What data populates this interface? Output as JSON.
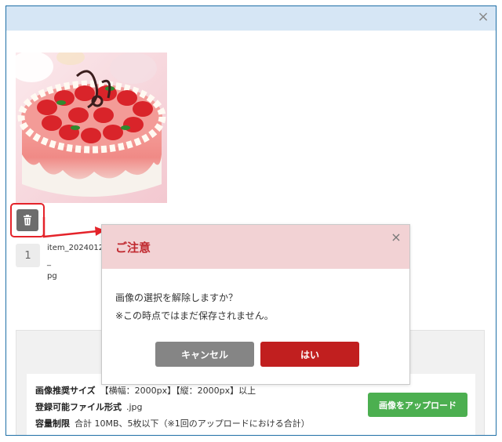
{
  "window": {
    "close_icon": "×"
  },
  "photo": {
    "alt": "strawberry-cake-photo"
  },
  "item": {
    "number": "1",
    "filename": "item_20240123_\npg"
  },
  "upload": {
    "recommended_size_label": "画像推奨サイズ",
    "recommended_size_value": "【横幅：2000px】【縦：2000px】以上",
    "formats_label": "登録可能ファイル形式",
    "formats_value": ".jpg",
    "limit_label": "容量制限",
    "limit_value": "合計 10MB、5枚以下（※1回のアップロードにおける合計）",
    "button_label": "画像をアップロード"
  },
  "modal": {
    "title": "ご注意",
    "close_icon": "×",
    "message_line1": "画像の選択を解除しますか？",
    "message_line2": "※この時点ではまだ保存されません。",
    "cancel_label": "キャンセル",
    "confirm_label": "はい"
  },
  "colors": {
    "accent_red": "#e4232a",
    "modal_title": "#c0292f",
    "confirm_button": "#c11f1f",
    "upload_button": "#4caf50"
  }
}
